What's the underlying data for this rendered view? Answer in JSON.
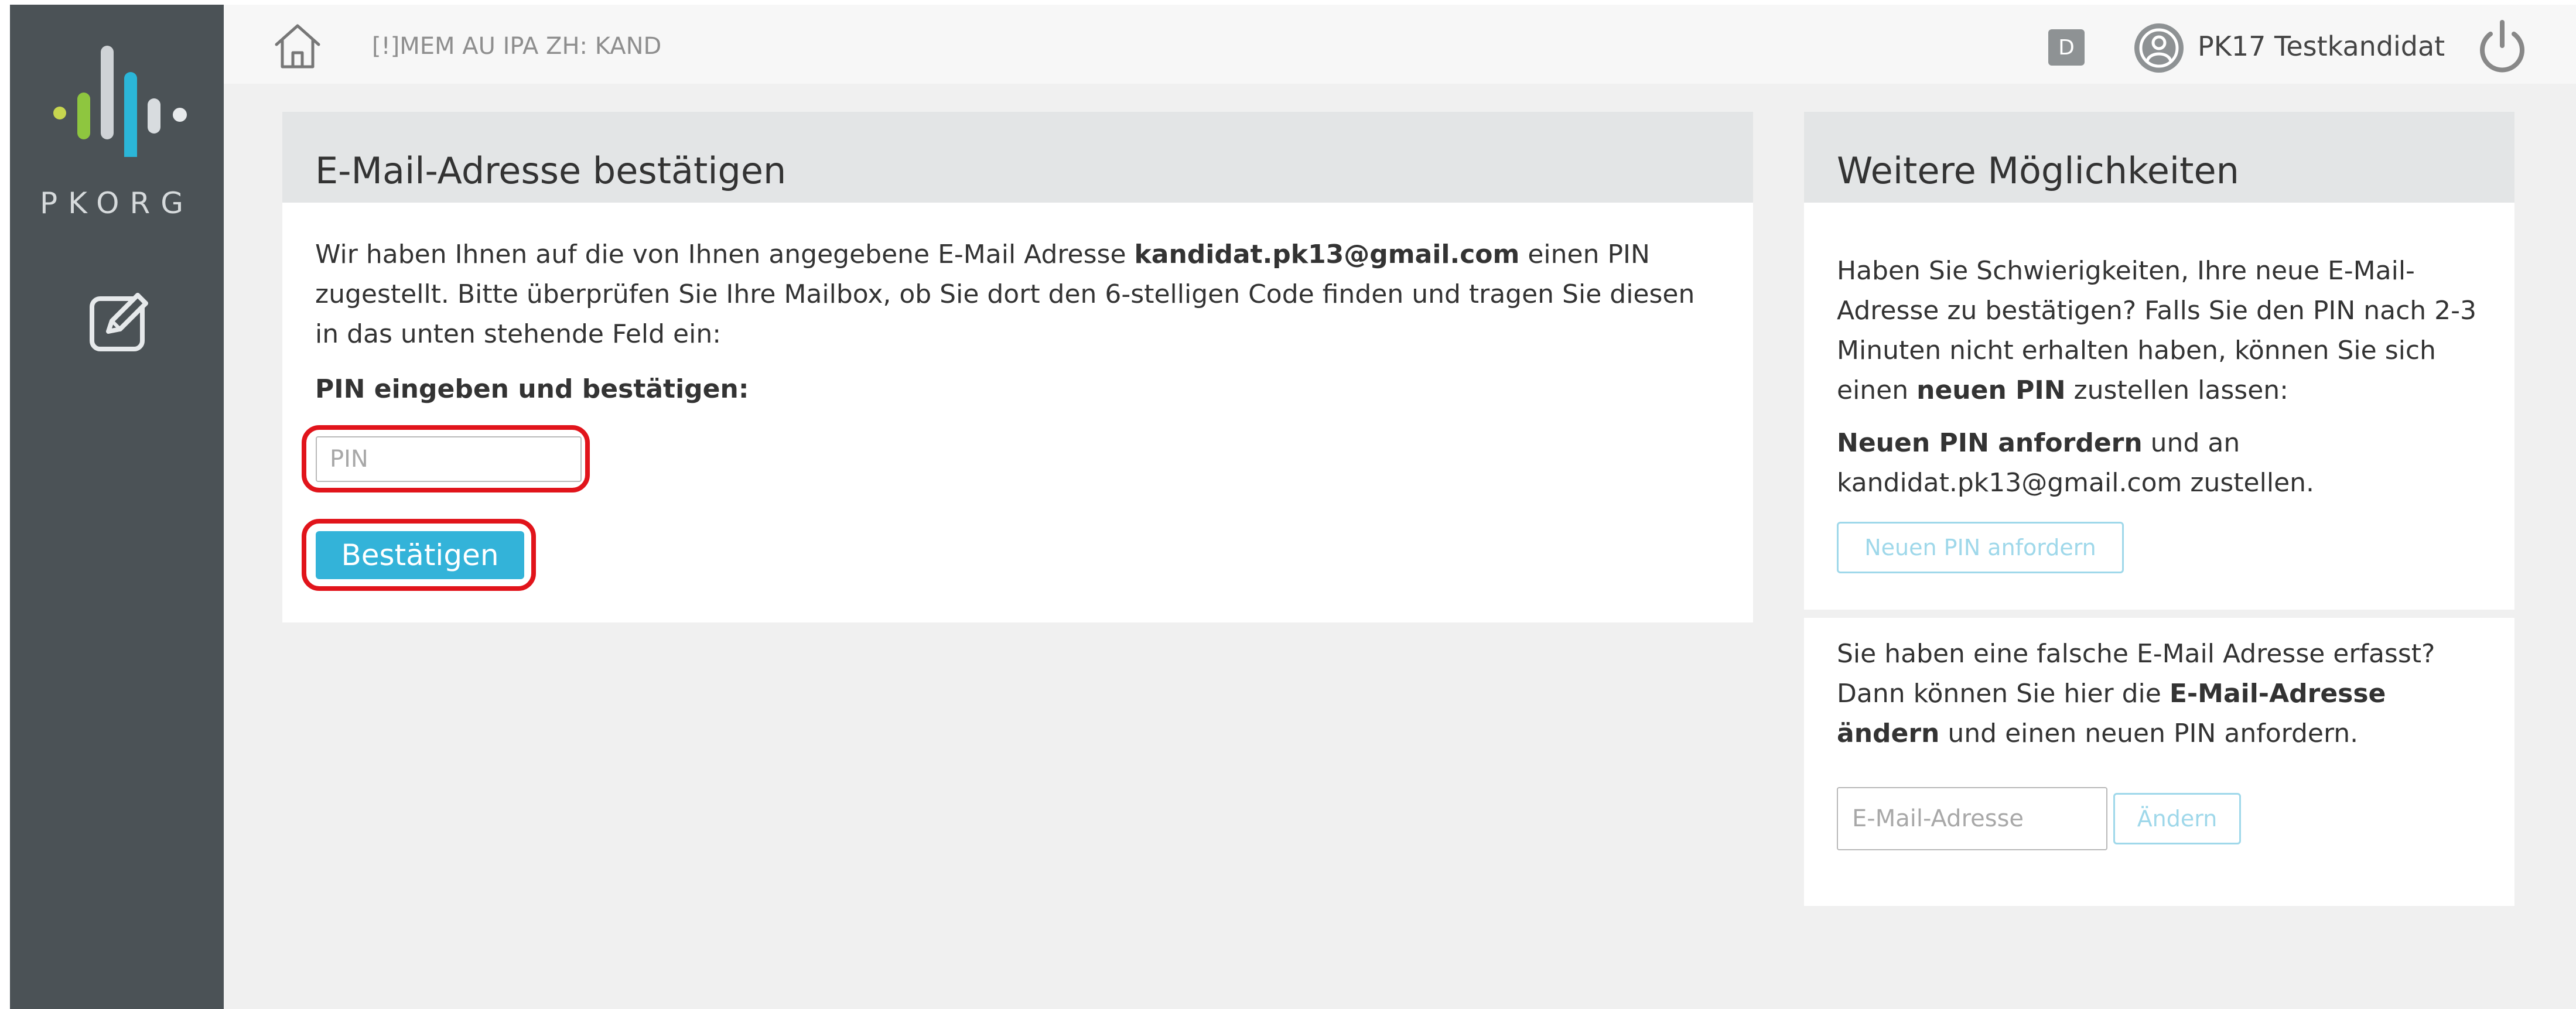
{
  "sidebar": {
    "logo_text": "PKORG",
    "logo_icon": "pkorg-logo",
    "edit_icon": "edit-icon"
  },
  "topbar": {
    "home_icon": "home-icon",
    "breadcrumb": "[!]MEM AU IPA ZH: KAND",
    "badge": "D",
    "user_icon": "user-icon",
    "user_name": "PK17 Testkandidat",
    "power_icon": "power-icon"
  },
  "confirm_panel": {
    "title": "E-Mail-Adresse bestätigen",
    "intro_before": "Wir haben Ihnen auf die von Ihnen angegebene E-Mail Adresse ",
    "email": "kandidat.pk13@gmail.com",
    "intro_after": " einen PIN zugestellt. Bitte überprüfen Sie Ihre Mailbox, ob Sie dort den 6-stelligen Code finden und tragen Sie diesen in das unten stehende Feld ein:",
    "pin_label": "PIN eingeben und bestätigen:",
    "pin_placeholder": "PIN",
    "pin_value": "",
    "confirm_button": "Bestätigen"
  },
  "options_panel": {
    "title": "Weitere Möglichkeiten",
    "help_text_before": "Haben Sie Schwierigkeiten, Ihre neue E-Mail-Adresse zu bestätigen? Falls Sie den PIN nach 2-3 Minuten nicht erhalten haben, können Sie sich einen ",
    "help_text_bold": "neuen PIN",
    "help_text_after": " zustellen lassen:",
    "request_bold": "Neuen PIN anfordern",
    "request_text": " und an kandidat.pk13@gmail.com zustellen.",
    "request_button": "Neuen PIN anfordern"
  },
  "change_panel": {
    "text_before": "Sie haben eine falsche E-Mail Adresse erfasst? Dann können Sie hier die ",
    "text_bold": "E-Mail-Adresse ändern",
    "text_after": " und einen neuen PIN anfordern.",
    "email_placeholder": "E-Mail-Adresse",
    "email_value": "",
    "change_button": "Ändern"
  },
  "colors": {
    "sidebar": "#4b5256",
    "primary_button": "#33b3d9",
    "highlight": "#e1141b",
    "panel_header": "#e3e5e6",
    "background": "#f0f0f0"
  }
}
